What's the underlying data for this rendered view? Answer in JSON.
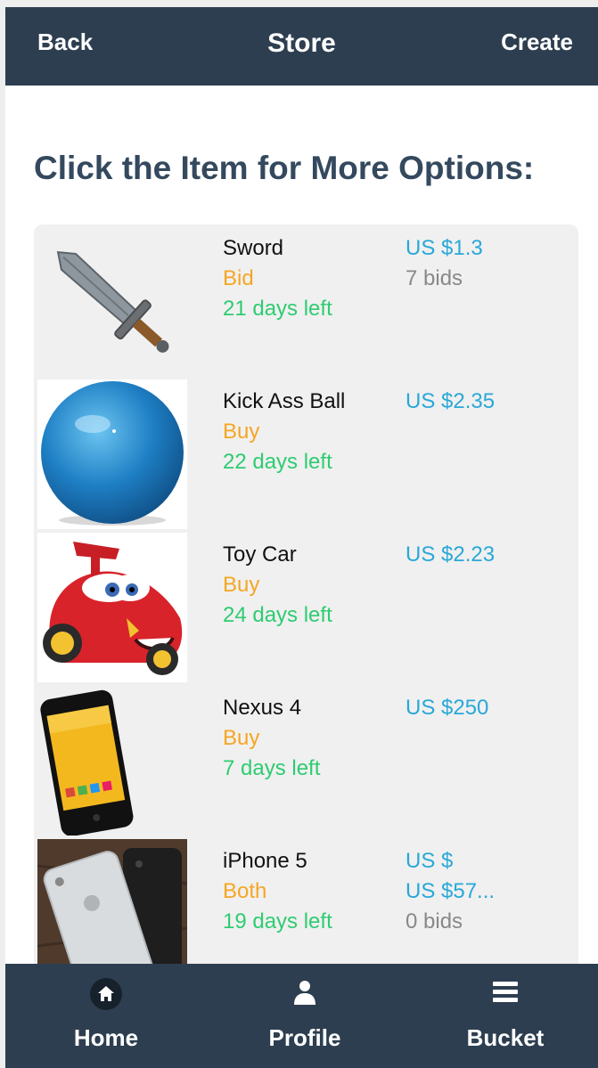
{
  "header": {
    "back_label": "Back",
    "title": "Store",
    "create_label": "Create"
  },
  "heading": "Click the Item for More Options:",
  "items": [
    {
      "name": "Sword",
      "type": "Bid",
      "days": "21 days left",
      "price": "US $1.3",
      "price2": "",
      "bids": "7 bids",
      "icon": "sword-image"
    },
    {
      "name": "Kick Ass Ball",
      "type": "Buy",
      "days": "22 days left",
      "price": "US $2.35",
      "price2": "",
      "bids": "",
      "icon": "ball-image"
    },
    {
      "name": "Toy Car",
      "type": "Buy",
      "days": "24 days left",
      "price": "US $2.23",
      "price2": "",
      "bids": "",
      "icon": "toy-car-image"
    },
    {
      "name": "Nexus 4",
      "type": "Buy",
      "days": "7 days left",
      "price": "US $250",
      "price2": "",
      "bids": "",
      "icon": "phone-image"
    },
    {
      "name": "iPhone 5",
      "type": "Both",
      "days": "19 days left",
      "price": "US $",
      "price2": "US $57...",
      "bids": "0 bids",
      "icon": "phone-image"
    }
  ],
  "tabs": [
    {
      "label": "Home",
      "icon": "home-icon"
    },
    {
      "label": "Profile",
      "icon": "user-icon"
    },
    {
      "label": "Bucket",
      "icon": "menu-icon"
    }
  ],
  "colors": {
    "bar": "#2d3e50",
    "heading": "#34495e",
    "type": "#f5a623",
    "days": "#2ecc71",
    "price": "#29a8d8",
    "bids": "#888888"
  }
}
